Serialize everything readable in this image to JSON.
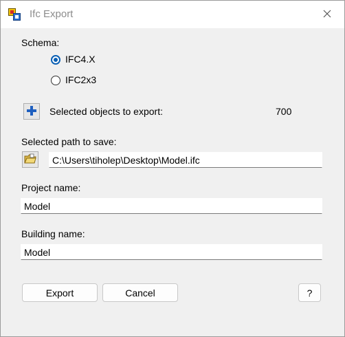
{
  "window": {
    "title": "Ifc Export",
    "close_icon": "close-icon",
    "app_icon": "ifc-app-icon"
  },
  "schema": {
    "label": "Schema:",
    "options": [
      {
        "label": "IFC4.X",
        "selected": true
      },
      {
        "label": "IFC2x3",
        "selected": false
      }
    ]
  },
  "selection": {
    "add_icon": "plus-icon",
    "label": "Selected objects to export:",
    "count": "700"
  },
  "save_path": {
    "label": "Selected path to save:",
    "browse_icon": "folder-icon",
    "value": "C:\\Users\\tiholep\\Desktop\\Model.ifc"
  },
  "project": {
    "label": "Project name:",
    "value": "Model"
  },
  "building": {
    "label": "Building name:",
    "value": "Model"
  },
  "buttons": {
    "export": "Export",
    "cancel": "Cancel",
    "help": "?"
  },
  "colors": {
    "accent": "#0a5fb4",
    "plus": "#1f5fbf"
  }
}
